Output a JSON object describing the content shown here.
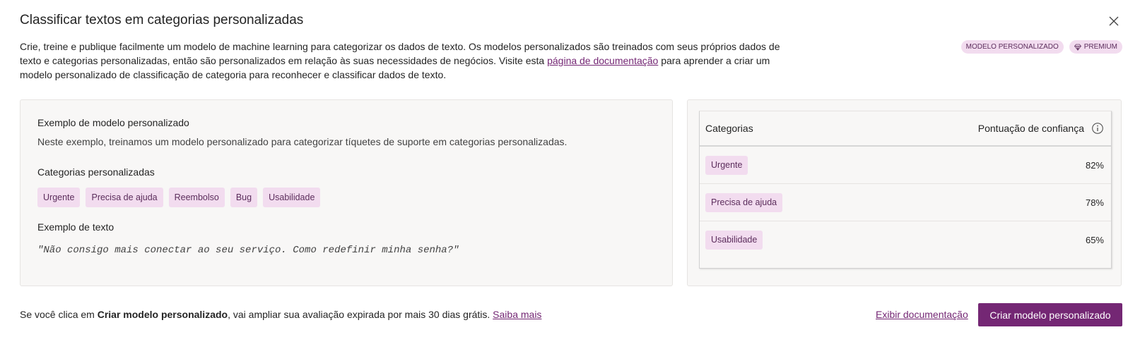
{
  "dialog": {
    "title": "Classificar textos em categorias personalizadas",
    "close_icon": "close-icon",
    "description_before_link": "Crie, treine e publique facilmente um modelo de machine learning para categorizar os dados de texto. Os modelos personalizados são treinados com seus próprios dados de texto e categorias personalizadas, então são personalizados em relação às suas necessidades de negócios. Visite esta ",
    "description_link": "página de documentação",
    "description_after_link": " para aprender a criar um modelo personalizado de classificação de categoria para reconhecer e classificar dados de texto.",
    "badges": {
      "custom_model": "MODELO PERSONALIZADO",
      "premium": "PREMIUM",
      "premium_icon": "diamond-icon"
    }
  },
  "example": {
    "heading": "Exemplo de modelo personalizado",
    "text": "Neste exemplo, treinamos um modelo personalizado para categorizar tíquetes de suporte em categorias personalizadas.",
    "categories_heading": "Categorias personalizadas",
    "categories": [
      "Urgente",
      "Precisa de ajuda",
      "Reembolso",
      "Bug",
      "Usabilidade"
    ],
    "sample_heading": "Exemplo de texto",
    "sample_text": "\"Não consigo mais conectar ao seu serviço. Como redefinir minha senha?\""
  },
  "results": {
    "col_categories": "Categorias",
    "col_score": "Pontuação de confiança",
    "info_icon": "info-icon",
    "rows": [
      {
        "category": "Urgente",
        "score": "82%"
      },
      {
        "category": "Precisa de ajuda",
        "score": "78%"
      },
      {
        "category": "Usabilidade",
        "score": "65%"
      }
    ]
  },
  "footer": {
    "text_before": "Se você clica em ",
    "text_bold": "Criar modelo personalizado",
    "text_after": ", vai ampliar sua avaliação expirada por mais 30 dias grátis. ",
    "learn_more": "Saiba mais",
    "view_docs": "Exibir documentação",
    "create_button": "Criar modelo personalizado"
  },
  "colors": {
    "accent": "#742774",
    "chip_bg": "#f2dcef",
    "chip_text": "#5c2d5c",
    "panel_bg": "#f8f7f6"
  }
}
